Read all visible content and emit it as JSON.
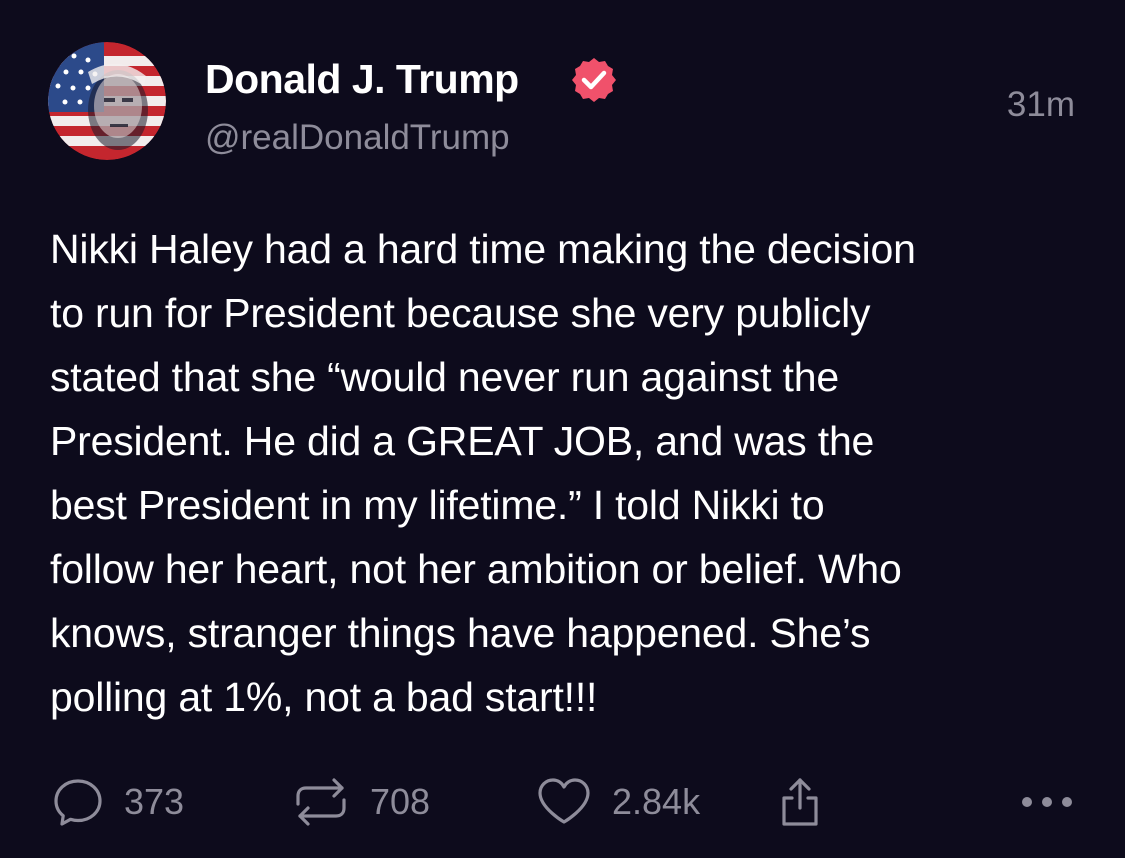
{
  "author": {
    "display_name": "Donald J. Trump",
    "handle": "@realDonaldTrump",
    "verified": true,
    "verified_badge_color": "#f0516b",
    "avatar_icon": "profile-photo-flag-portrait"
  },
  "post": {
    "timestamp": "31m",
    "lines": [
      "Nikki Haley had a hard time making the decision",
      "to run for President because she very publicly",
      "stated that she “would never run against the",
      "President. He did a GREAT JOB, and was the",
      "best President in my lifetime.” I told Nikki to",
      "follow her heart, not her ambition or belief. Who",
      "knows, stranger things have happened. She’s",
      "polling at 1%, not a bad start!!!"
    ]
  },
  "actions": {
    "reply": {
      "icon": "comment-bubble-icon",
      "count": "373"
    },
    "repost": {
      "icon": "repost-arrows-icon",
      "count": "708"
    },
    "like": {
      "icon": "heart-icon",
      "count": "2.84k"
    },
    "share": {
      "icon": "share-upload-icon"
    },
    "more": {
      "icon": "more-dots-icon"
    }
  },
  "colors": {
    "background": "#0d0b1c",
    "text_primary": "#ffffff",
    "text_secondary": "#8e8c9a"
  }
}
